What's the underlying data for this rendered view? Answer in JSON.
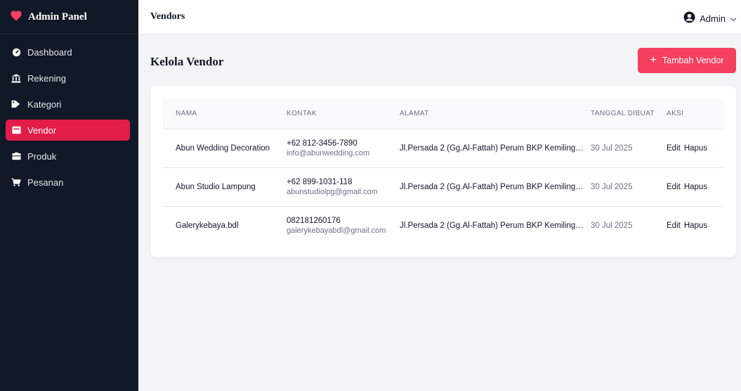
{
  "sidebar": {
    "brand": "Admin Panel",
    "items": [
      {
        "label": "Dashboard",
        "icon": "dashboard-icon"
      },
      {
        "label": "Rekening",
        "icon": "bank-icon"
      },
      {
        "label": "Kategori",
        "icon": "tag-icon"
      },
      {
        "label": "Vendor",
        "icon": "store-icon",
        "active": true
      },
      {
        "label": "Produk",
        "icon": "box-icon"
      },
      {
        "label": "Pesanan",
        "icon": "cart-icon"
      }
    ]
  },
  "topbar": {
    "title": "Vendors",
    "user": "Admin"
  },
  "main": {
    "title": "Kelola Vendor",
    "add_button": "Tambah Vendor",
    "columns": [
      "NAMA",
      "KONTAK",
      "ALAMAT",
      "TANGGAL DIBUAT",
      "AKSI"
    ],
    "rows": [
      {
        "name": "Abun Wedding Decoration",
        "phone": "+62 812-3456-7890",
        "email": "info@abunwedding.com",
        "address": "Jl.Persada 2 (Gg.Al-Fattah) Perum BKP Kemiling…",
        "date": "30 Jul 2025",
        "edit": "Edit",
        "delete": "Hapus"
      },
      {
        "name": "Abun Studio Lampung",
        "phone": "+62 899-1031-118",
        "email": "abunstudiolpg@gmail.com",
        "address": "Jl.Persada 2 (Gg.Al-Fattah) Perum BKP Kemiling…",
        "date": "30 Jul 2025",
        "edit": "Edit",
        "delete": "Hapus"
      },
      {
        "name": "Galerykebaya.bdl",
        "phone": "082181260176",
        "email": "galerykebayabdl@gmail.com",
        "address": "Jl.Persada 2 (Gg.Al-Fattah) Perum BKP Kemiling…",
        "date": "30 Jul 2025",
        "edit": "Edit",
        "delete": "Hapus"
      }
    ]
  },
  "colors": {
    "sidebar_bg": "#111827",
    "accent": "#e11d48",
    "button": "#f43f5e"
  }
}
